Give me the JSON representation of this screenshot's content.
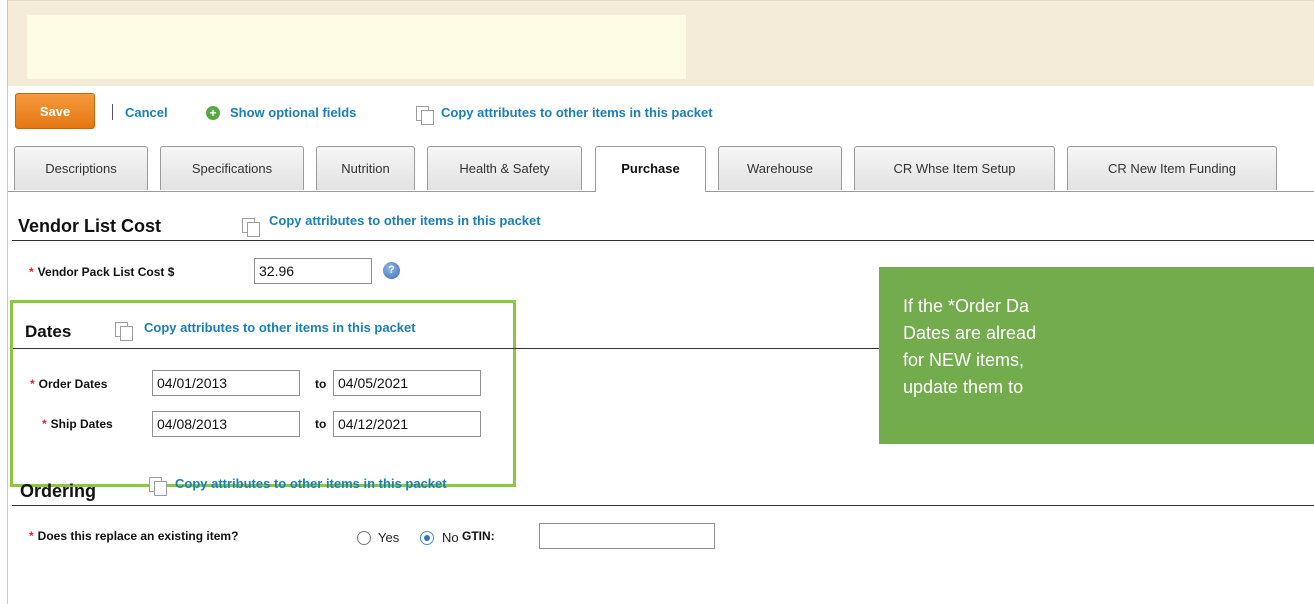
{
  "toolbar": {
    "save_label": "Save",
    "cancel_label": "Cancel",
    "optional_label": "Show optional fields",
    "copy_label": "Copy attributes to other items in this packet"
  },
  "tabs": [
    {
      "label": "Descriptions"
    },
    {
      "label": "Specifications"
    },
    {
      "label": "Nutrition"
    },
    {
      "label": "Health & Safety"
    },
    {
      "label": "Purchase",
      "active": true
    },
    {
      "label": "Warehouse"
    },
    {
      "label": "CR Whse Item Setup"
    },
    {
      "label": "CR New Item Funding"
    }
  ],
  "vendor": {
    "title": "Vendor List Cost",
    "copy_label": "Copy attributes to other items in this packet",
    "cost_label": "Vendor Pack List Cost $",
    "cost_value": "32.96",
    "help_icon": "?"
  },
  "dates": {
    "title": "Dates",
    "copy_label": "Copy attributes to other items in this packet",
    "order_label": "Order Dates",
    "order_from": "04/01/2013",
    "order_to": "04/05/2021",
    "ship_label": "Ship Dates",
    "ship_from": "04/08/2013",
    "ship_to": "04/12/2021",
    "to_label": "to"
  },
  "ordering": {
    "title": "Ordering",
    "copy_label": "Copy attributes to other items in this packet",
    "replace_label": "Does this replace an existing item?",
    "yes_label": "Yes",
    "no_label": "No",
    "selected": "No",
    "gtin_label": "GTIN:",
    "gtin_value": ""
  },
  "required_marker": "*",
  "callout": {
    "lines": [
      "If the *Order Da",
      "Dates are alread",
      "for NEW items,",
      "update them to"
    ]
  },
  "colors": {
    "accent_link": "#1a7fb5",
    "save_button": "#e57712",
    "highlight_border": "#8dc63f",
    "callout_bg": "#72ac4d",
    "required": "#d8262b"
  }
}
